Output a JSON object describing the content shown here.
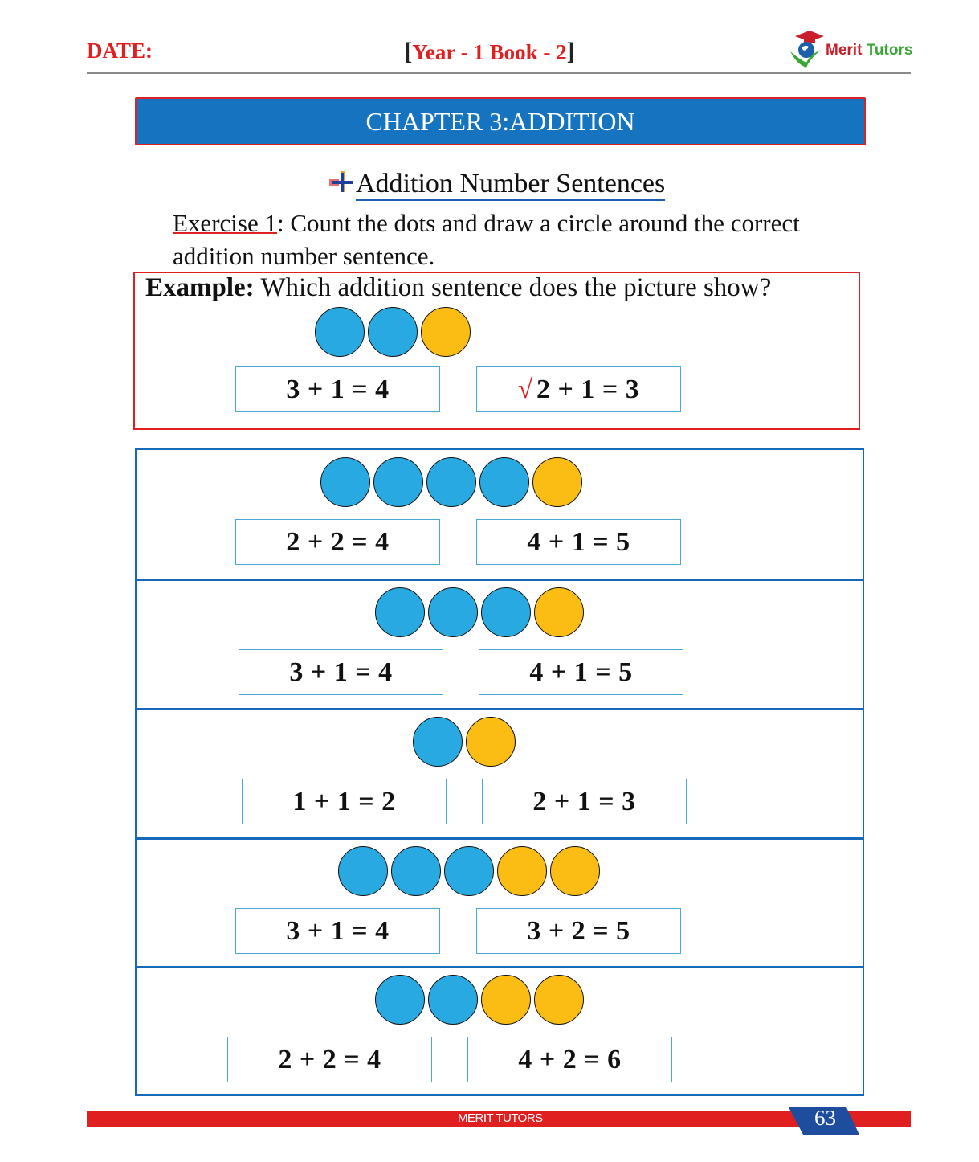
{
  "header": {
    "date_label": "DATE:",
    "bracket_open": "[",
    "book_title": "Year - 1 Book - 2",
    "bracket_close": "]",
    "logo_text_1": "Merit",
    "logo_text_2": "Tutors"
  },
  "chapter": {
    "title": "CHAPTER 3:ADDITION"
  },
  "section": {
    "heading": "Addition Number Sentences"
  },
  "exercise": {
    "label": "Exercise 1",
    "instructions": ": Count the dots and draw a circle around the correct addition number sentence."
  },
  "example": {
    "label": "Example:",
    "question": " Which addition sentence does the picture show?",
    "dots": [
      "blue",
      "blue",
      "yellow"
    ],
    "options": [
      "3 + 1 = 4",
      "2 + 1 = 3"
    ],
    "check_mark": "√"
  },
  "problems": [
    {
      "dots": [
        "blue",
        "blue",
        "blue",
        "blue",
        "yellow"
      ],
      "options": [
        "2 + 2 = 4",
        "4 + 1 = 5"
      ]
    },
    {
      "dots": [
        "blue",
        "blue",
        "blue",
        "yellow"
      ],
      "options": [
        "3 + 1 = 4",
        "4 + 1 = 5"
      ]
    },
    {
      "dots": [
        "blue",
        "yellow"
      ],
      "options": [
        "1 + 1 = 2",
        "2 + 1 = 3"
      ]
    },
    {
      "dots": [
        "blue",
        "blue",
        "blue",
        "yellow",
        "yellow"
      ],
      "options": [
        "3 + 1 = 4",
        "3 + 2 = 5"
      ]
    },
    {
      "dots": [
        "blue",
        "blue",
        "yellow",
        "yellow"
      ],
      "options": [
        "2 + 2 = 4",
        "4 + 2 = 6"
      ]
    }
  ],
  "footer": {
    "brand": "MERIT TUTORS",
    "page_number": "63"
  },
  "colors": {
    "accent_red": "#e02020",
    "banner_blue": "#1673bf",
    "dot_blue": "#29a9e1",
    "dot_yellow": "#fbbd13"
  }
}
